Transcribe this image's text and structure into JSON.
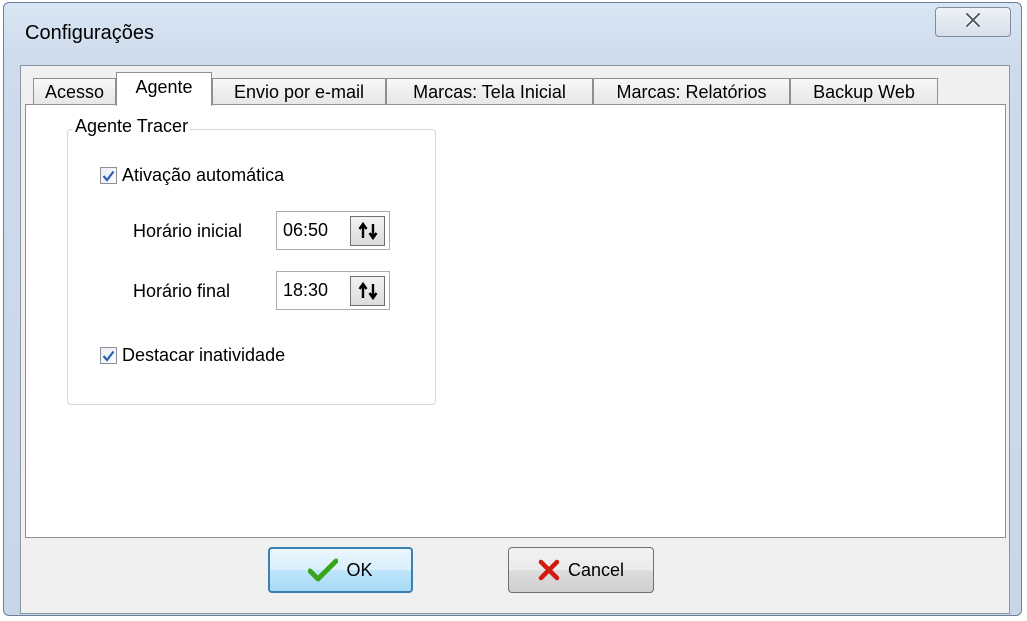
{
  "window": {
    "title": "Configurações"
  },
  "tabs": [
    {
      "label": "Acesso"
    },
    {
      "label": "Agente",
      "active": true
    },
    {
      "label": "Envio por e-mail"
    },
    {
      "label": "Marcas: Tela Inicial"
    },
    {
      "label": "Marcas: Relatórios"
    },
    {
      "label": "Backup Web"
    }
  ],
  "agent": {
    "group_title": "Agente Tracer",
    "auto_activation": {
      "label": "Ativação automática",
      "checked": true
    },
    "start_time": {
      "label": "Horário inicial",
      "value": "06:50"
    },
    "end_time": {
      "label": "Horário final",
      "value": "18:30"
    },
    "highlight_inactivity": {
      "label": "Destacar inatividade",
      "checked": true
    }
  },
  "buttons": {
    "ok_label": "OK",
    "cancel_label": "Cancel"
  },
  "icons": {
    "close": "close-x-icon",
    "check": "checkmark-icon",
    "spin": "spin-arrows-icon",
    "ok": "green-check-icon",
    "cancel": "red-x-icon"
  },
  "colors": {
    "ok_icon": "#3aa51c",
    "cancel_icon": "#d21a0f",
    "checkbox_check": "#2b5fb4"
  }
}
